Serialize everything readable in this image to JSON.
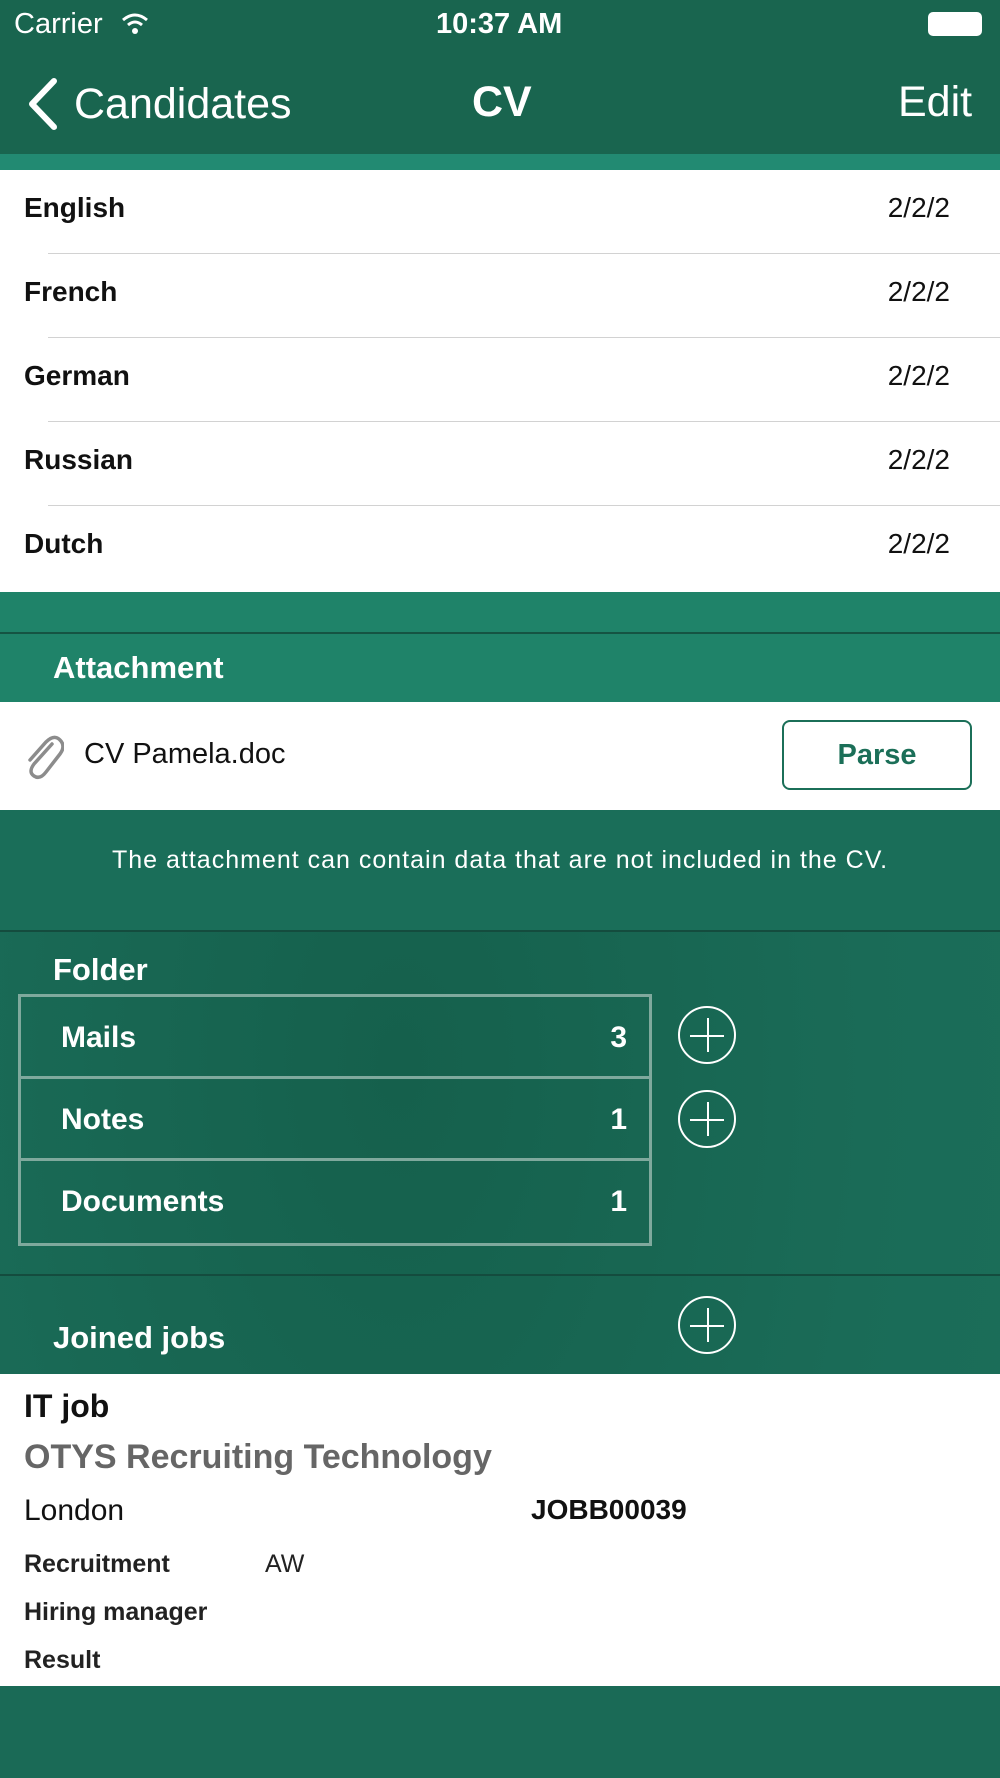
{
  "status_bar": {
    "carrier": "Carrier",
    "time": "10:37 AM"
  },
  "nav": {
    "back_label": "Candidates",
    "title": "CV",
    "edit_label": "Edit"
  },
  "languages": [
    {
      "name": "English",
      "value": "2/2/2"
    },
    {
      "name": "French",
      "value": "2/2/2"
    },
    {
      "name": "German",
      "value": "2/2/2"
    },
    {
      "name": "Russian",
      "value": "2/2/2"
    },
    {
      "name": "Dutch",
      "value": "2/2/2"
    }
  ],
  "attachment": {
    "section_title": "Attachment",
    "file_name": "CV Pamela.doc",
    "parse_label": "Parse",
    "note": "The attachment can contain data that are not included in the CV."
  },
  "folder": {
    "section_title": "Folder",
    "items": [
      {
        "label": "Mails",
        "count": "3"
      },
      {
        "label": "Notes",
        "count": "1"
      },
      {
        "label": "Documents",
        "count": "1"
      }
    ]
  },
  "joined_jobs": {
    "section_title": "Joined jobs",
    "job": {
      "title": "IT job",
      "company": "OTYS Recruiting Technology",
      "location": "London",
      "code": "JOBB00039",
      "recruitment_label": "Recruitment",
      "recruitment_value": "AW",
      "hiring_manager_label": "Hiring manager",
      "result_label": "Result"
    }
  },
  "colors": {
    "primary": "#19654f",
    "accent": "#1f8369",
    "white": "#ffffff"
  }
}
